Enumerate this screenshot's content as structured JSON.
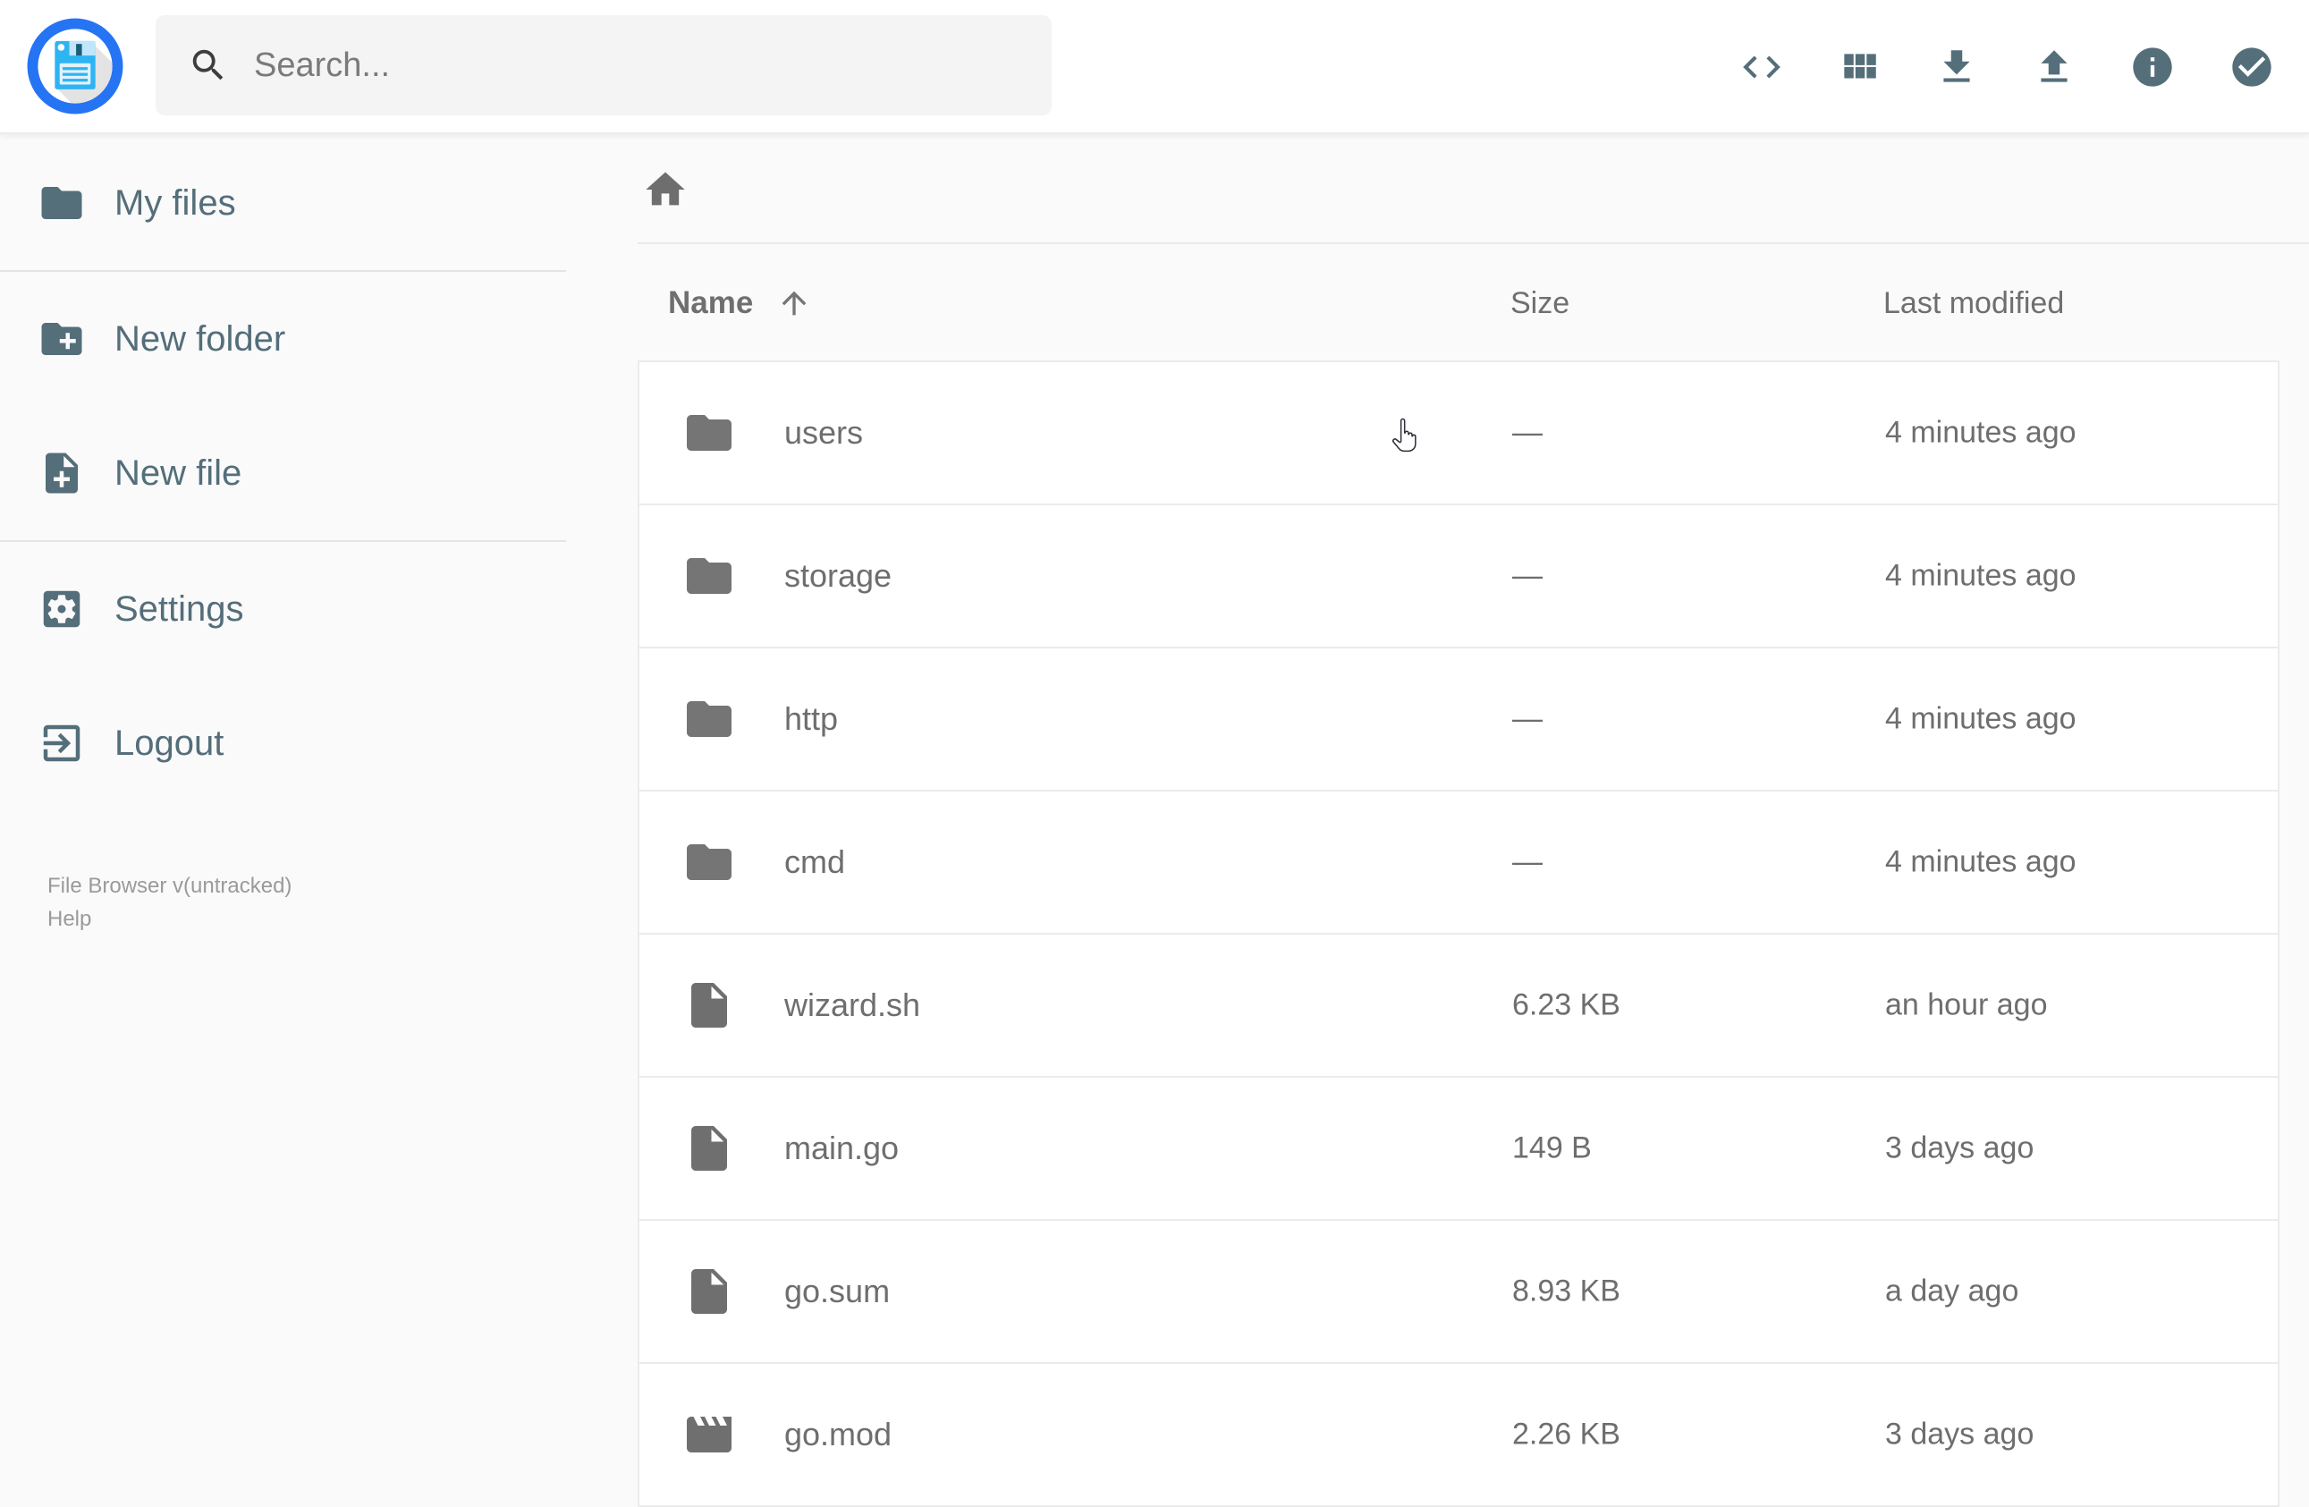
{
  "app": {
    "name": "File Browser"
  },
  "header": {
    "logo_icon": "floppy-disk-logo",
    "search": {
      "placeholder": "Search...",
      "icon": "search-icon"
    },
    "action_icons": [
      "code-icon",
      "view-module-icon",
      "download-icon",
      "upload-icon",
      "info-icon",
      "check-circle-icon"
    ]
  },
  "sidebar": {
    "items": [
      {
        "icon": "folder-icon",
        "label": "My files"
      },
      {
        "icon": "new-folder-icon",
        "label": "New folder"
      },
      {
        "icon": "new-file-icon",
        "label": "New file"
      },
      {
        "icon": "settings-icon",
        "label": "Settings"
      },
      {
        "icon": "logout-icon",
        "label": "Logout"
      }
    ],
    "footer": {
      "version": "File Browser v(untracked)",
      "help": "Help"
    }
  },
  "breadcrumb": {
    "home_icon": "home-icon"
  },
  "listing": {
    "columns": {
      "name": "Name",
      "size": "Size",
      "modified": "Last modified"
    },
    "sort": {
      "column": "Name",
      "direction": "ascending",
      "icon": "arrow-up-icon"
    },
    "rows": [
      {
        "icon": "folder-icon",
        "name": "users",
        "size": "—",
        "modified": "4 minutes ago"
      },
      {
        "icon": "folder-icon",
        "name": "storage",
        "size": "—",
        "modified": "4 minutes ago"
      },
      {
        "icon": "folder-icon",
        "name": "http",
        "size": "—",
        "modified": "4 minutes ago"
      },
      {
        "icon": "folder-icon",
        "name": "cmd",
        "size": "—",
        "modified": "4 minutes ago"
      },
      {
        "icon": "file-icon",
        "name": "wizard.sh",
        "size": "6.23 KB",
        "modified": "an hour ago"
      },
      {
        "icon": "file-icon",
        "name": "main.go",
        "size": "149 B",
        "modified": "3 days ago"
      },
      {
        "icon": "file-icon",
        "name": "go.sum",
        "size": "8.93 KB",
        "modified": "a day ago"
      },
      {
        "icon": "movie-icon",
        "name": "go.mod",
        "size": "2.26 KB",
        "modified": "3 days ago"
      }
    ]
  },
  "cursor": {
    "shape": "hand-pointer"
  },
  "colors": {
    "accent_slate": "#546e7a",
    "text_gray": "#6e6e6e",
    "icon_gray": "#757575",
    "page_bg": "#fafafa",
    "card_bg": "#ffffff",
    "border": "#ebebeb",
    "logo_ring_blue": "#2574f4",
    "logo_floppy_blue": "#2fb4f3"
  }
}
